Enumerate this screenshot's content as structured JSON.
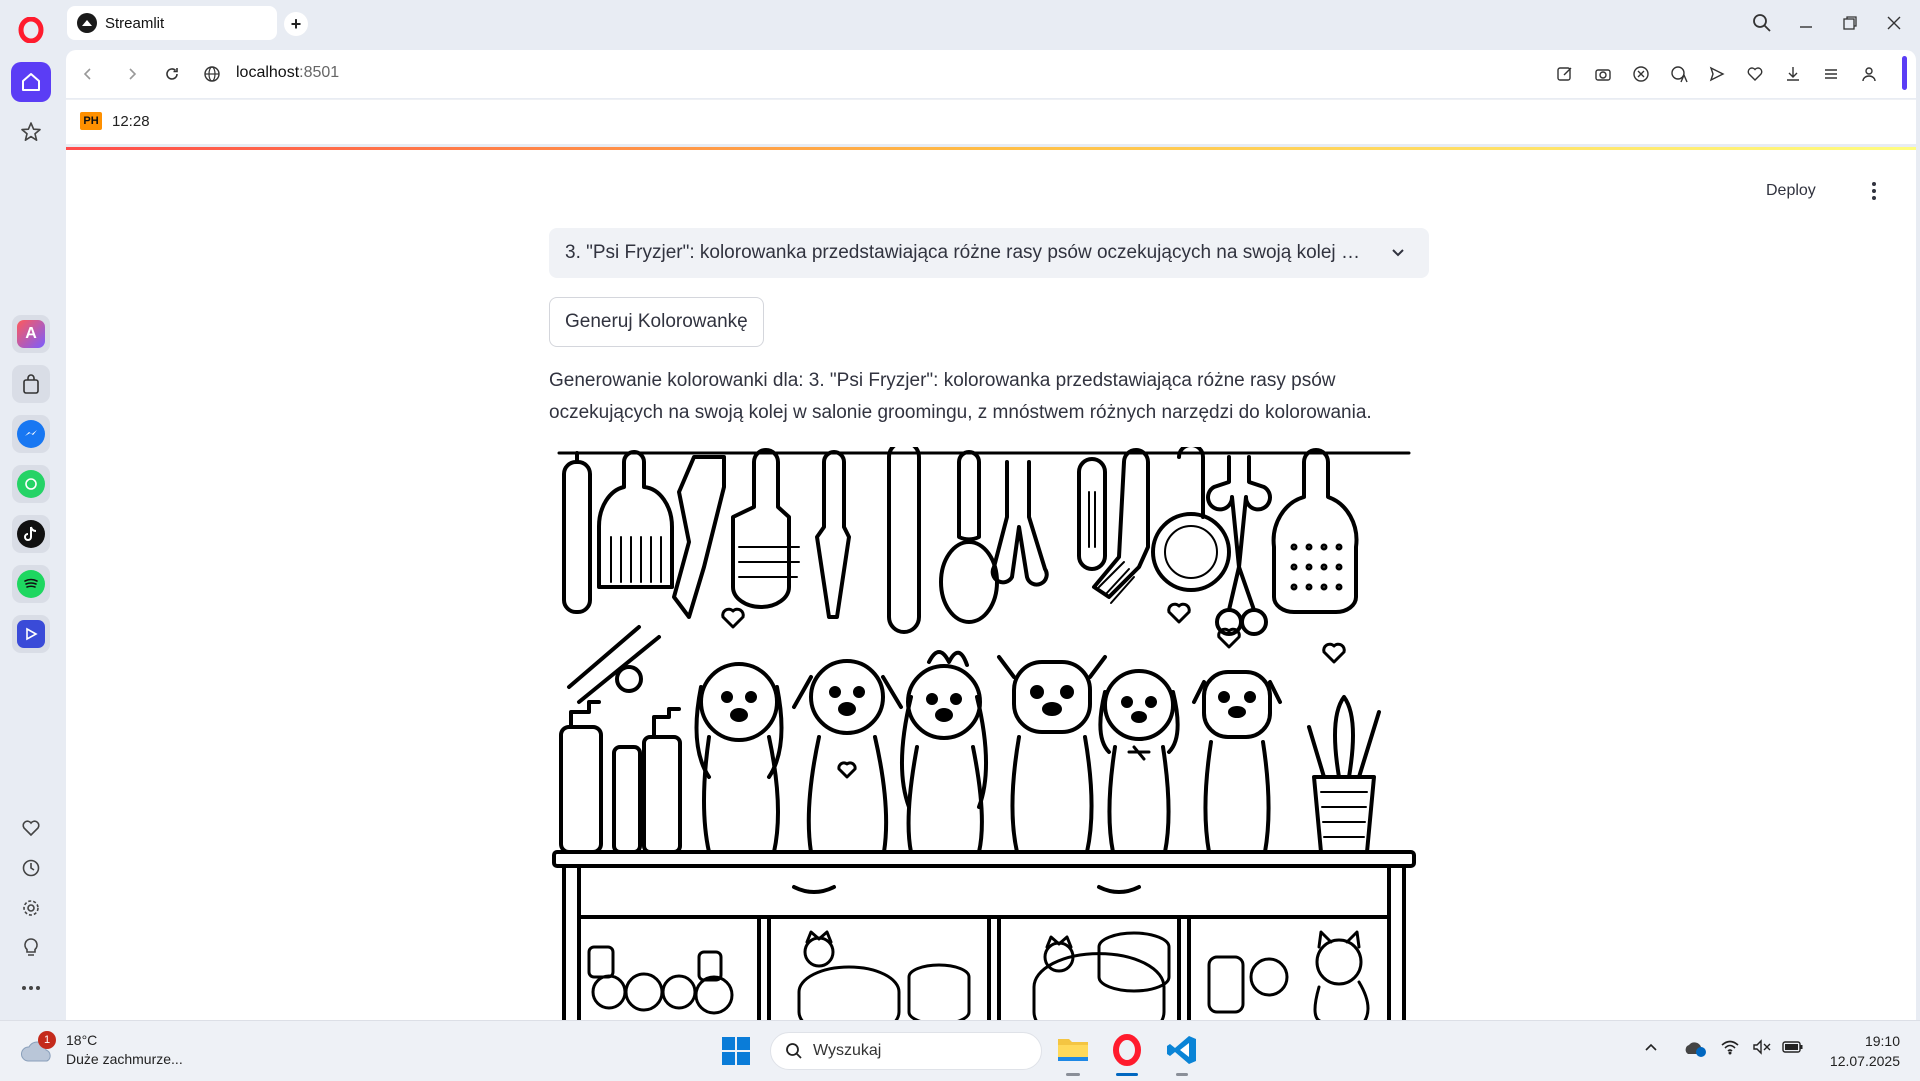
{
  "browser": {
    "tab_title": "Streamlit",
    "url_host": "localhost",
    "url_port": ":8501",
    "bookmark_label": "12:28",
    "bookmark_badge": "PH"
  },
  "app": {
    "deploy_label": "Deploy",
    "select_value": "3. \"Psi Fryzjer\": kolorowanka przedstawiająca różne rasy psów oczekujących na swoją kolej w salonie groomingu, z mnóstwem różnych narzędzi do kolorowania.",
    "generate_button": "Generuj Kolorowankę",
    "generating_message": "Generowanie kolorowanki dla: 3. \"Psi Fryzjer\": kolorowanka przedstawiająca różne rasy psów oczekujących na swoją kolej w salonie groomingu, z mnóstwem różnych narzędzi do kolorowania."
  },
  "taskbar": {
    "weather_temp": "18°C",
    "weather_desc": "Duże zachmurze...",
    "weather_badge": "1",
    "search_placeholder": "Wyszukaj",
    "time": "19:10",
    "date": "12.07.2025"
  },
  "colors": {
    "opera_red": "#ff1b2d",
    "streamlit_text": "#31333f",
    "accent_purple": "#5b3df5"
  }
}
